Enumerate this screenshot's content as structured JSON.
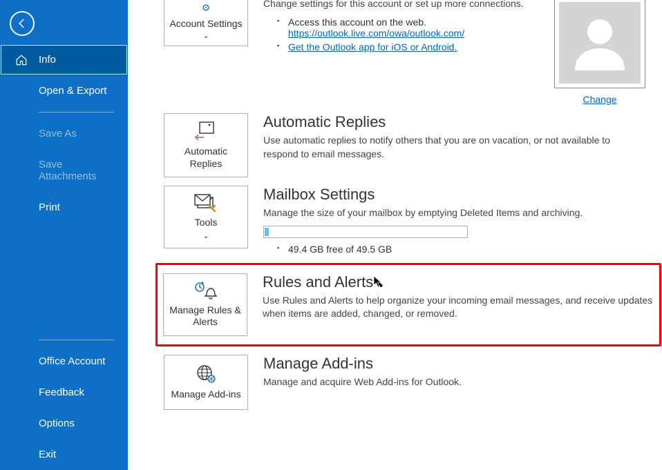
{
  "sidebar": {
    "items": [
      {
        "label": "Info",
        "selected": true
      },
      {
        "label": "Open & Export"
      },
      {
        "label": "Save As",
        "disabled": true
      },
      {
        "label": "Save Attachments",
        "disabled": true
      },
      {
        "label": "Print"
      }
    ],
    "bottom": [
      {
        "label": "Office Account"
      },
      {
        "label": "Feedback"
      },
      {
        "label": "Options"
      },
      {
        "label": "Exit"
      }
    ]
  },
  "account_tile": {
    "label": "Account Settings"
  },
  "account_desc": "Change settings for this account or set up more connections.",
  "account_links": {
    "web_text": "Access this account on the web.",
    "web_url": "https://outlook.live.com/owa/outlook.com/",
    "app_link": "Get the Outlook app for iOS or Android."
  },
  "avatar_change": "Change",
  "auto_replies": {
    "tile": "Automatic Replies",
    "heading": "Automatic Replies",
    "desc": "Use automatic replies to notify others that you are on vacation, or not available to respond to email messages."
  },
  "mailbox": {
    "tile": "Tools",
    "heading": "Mailbox Settings",
    "desc": "Manage the size of your mailbox by emptying Deleted Items and archiving.",
    "free": "49.4 GB free of 49.5 GB"
  },
  "rules": {
    "tile": "Manage Rules & Alerts",
    "heading": "Rules and Alerts",
    "desc": "Use Rules and Alerts to help organize your incoming email messages, and receive updates when items are added, changed, or removed."
  },
  "addins": {
    "tile": "Manage Add-ins",
    "heading": "Manage Add-ins",
    "desc": "Manage and acquire Web Add-ins for Outlook."
  }
}
